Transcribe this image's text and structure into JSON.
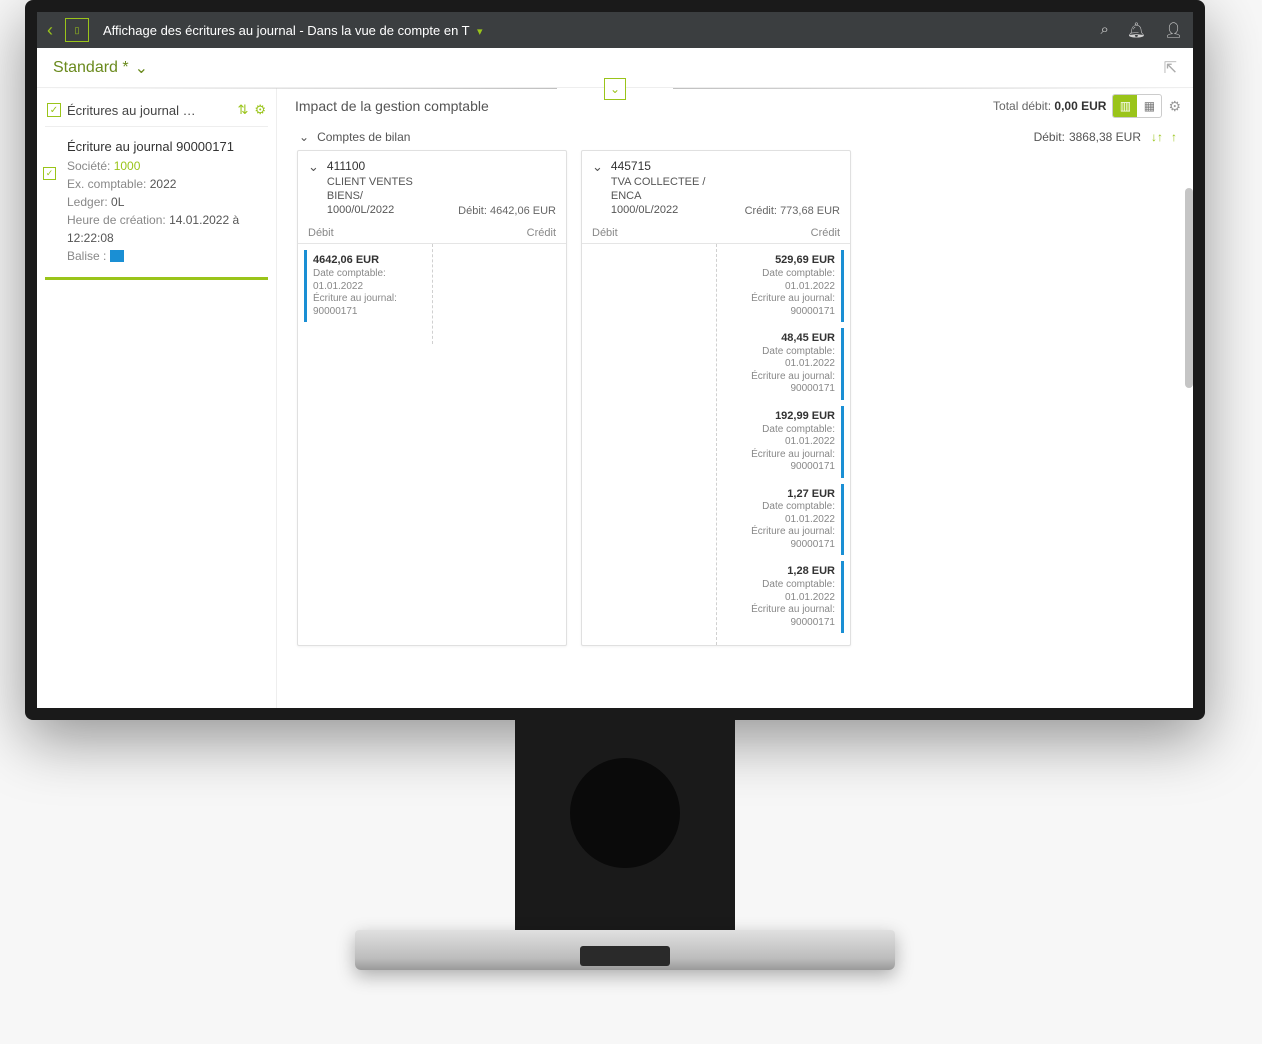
{
  "header": {
    "title": "Affichage des écritures au journal - Dans la vue de compte en T",
    "dropdown_indicator": "▾"
  },
  "variant": {
    "name": "Standard *"
  },
  "sidebar": {
    "title": "Écritures au journal …",
    "entry": {
      "title": "Écriture au journal 90000171",
      "company_label": "Société:",
      "company_value": "1000",
      "fiscal_label": "Ex. comptable:",
      "fiscal_value": "2022",
      "ledger_label": "Ledger:",
      "ledger_value": "0L",
      "created_label": "Heure de création:",
      "created_value": "14.01.2022 à 12:22:08",
      "flag_label": "Balise :"
    }
  },
  "main": {
    "title": "Impact de la gestion comptable",
    "total_label": "Total débit:",
    "total_value": "0,00 EUR",
    "section_label": "Comptes de bilan",
    "section_debit_label": "Débit:",
    "section_debit_value": "3868,38 EUR"
  },
  "labels": {
    "debit": "Débit",
    "credit": "Crédit",
    "posting_date": "Date comptable:",
    "journal_entry": "Écriture au journal:"
  },
  "accounts": [
    {
      "number": "411100",
      "name": "CLIENT VENTES BIENS/",
      "sub": "1000/0L/2022",
      "side_label": "Débit:",
      "side_value": "4642,06 EUR",
      "debit_items": [
        {
          "amount": "4642,06 EUR",
          "date": "01.01.2022",
          "ref": "90000171"
        }
      ],
      "credit_items": []
    },
    {
      "number": "445715",
      "name": "TVA COLLECTEE / ENCA",
      "sub": "1000/0L/2022",
      "side_label": "Crédit:",
      "side_value": "773,68 EUR",
      "debit_items": [],
      "credit_items": [
        {
          "amount": "529,69 EUR",
          "date": "01.01.2022",
          "ref": "90000171"
        },
        {
          "amount": "48,45 EUR",
          "date": "01.01.2022",
          "ref": "90000171"
        },
        {
          "amount": "192,99 EUR",
          "date": "01.01.2022",
          "ref": "90000171"
        },
        {
          "amount": "1,27 EUR",
          "date": "01.01.2022",
          "ref": "90000171"
        },
        {
          "amount": "1,28 EUR",
          "date": "01.01.2022",
          "ref": "90000171"
        }
      ]
    }
  ]
}
